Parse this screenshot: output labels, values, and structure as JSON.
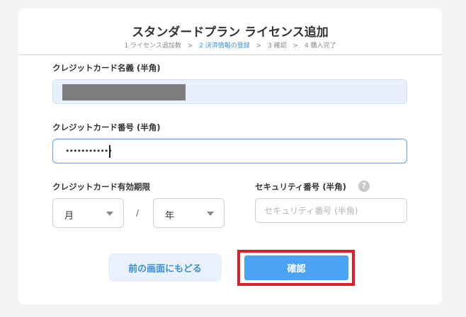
{
  "header": {
    "title": "スタンダードプラン ライセンス追加",
    "steps": [
      {
        "label": "1 ライセンス追加数",
        "active": false
      },
      {
        "label": "2 決済情報の登録",
        "active": true
      },
      {
        "label": "3 確認",
        "active": false
      },
      {
        "label": "4 購入完了",
        "active": false
      }
    ],
    "separator": ">"
  },
  "form": {
    "name_label": "クレジットカード名義 (半角)",
    "number_label": "クレジットカード番号 (半角)",
    "number_value": "••••••••••••",
    "expiry_label": "クレジットカード有効期限",
    "month_value": "月",
    "expiry_separator": "/",
    "year_value": "年",
    "security_label": "セキュリティ番号 (半角)",
    "security_placeholder": "セキュリティ番号 (半角)",
    "help_glyph": "?"
  },
  "actions": {
    "back_label": "前の画面にもどる",
    "confirm_label": "確認"
  },
  "colors": {
    "accent": "#4aa3f5",
    "active_step": "#3b8fd9",
    "highlight_frame": "#e21c2c"
  }
}
